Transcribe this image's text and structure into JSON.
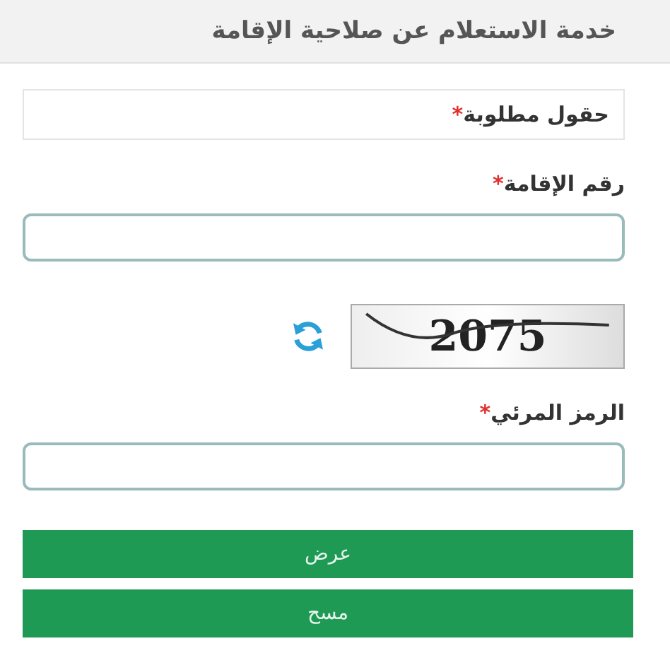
{
  "header": {
    "title": "خدمة الاستعلام عن صلاحية الإقامة"
  },
  "required_note": {
    "text": "حقول مطلوبة",
    "marker": "*"
  },
  "fields": [
    {
      "kind": "text",
      "label": "رقم الإقامة",
      "marker": "*"
    },
    {
      "kind": "captcha",
      "code": "2075"
    },
    {
      "kind": "text",
      "label": "الرمز المرئي",
      "marker": "*"
    }
  ],
  "buttons": [
    "عرض",
    "مسح"
  ]
}
